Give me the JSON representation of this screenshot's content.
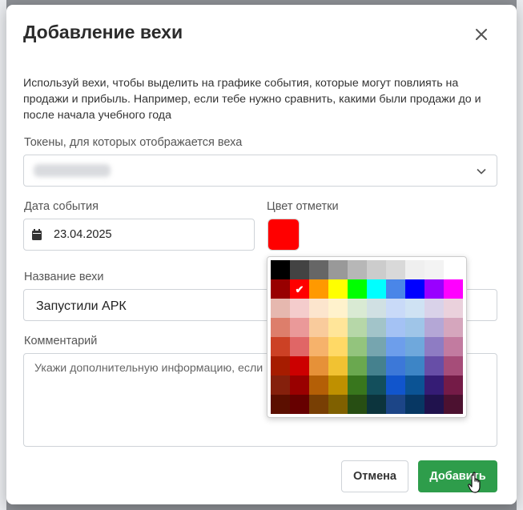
{
  "dialog": {
    "title": "Добавление вехи",
    "description": "Используй вехи, чтобы выделить на графике события, которые могут повлиять на продажи и прибыль. Например, если тебе нужно сравнить, какими были продажи до и после начала учебного года"
  },
  "tokens": {
    "label": "Токены, для которых отображается веха",
    "value": ""
  },
  "event_date": {
    "label": "Дата события",
    "value": "23.04.2025"
  },
  "marker_color": {
    "label": "Цвет отметки",
    "selected": "#ff0000"
  },
  "milestone_name": {
    "label": "Название вехи",
    "value": "Запустили АРК"
  },
  "comment": {
    "label": "Комментарий",
    "placeholder": "Укажи дополнительную информацию, если"
  },
  "palette": {
    "selected_index": 11,
    "rows": [
      [
        "#000000",
        "#434343",
        "#666666",
        "#999999",
        "#b7b7b7",
        "#cccccc",
        "#d9d9d9",
        "#efefef",
        "#f3f3f3",
        "#ffffff"
      ],
      [
        "#980000",
        "#ff0000",
        "#ff9900",
        "#ffff00",
        "#00ff00",
        "#00ffff",
        "#4a86e8",
        "#0000ff",
        "#9900ff",
        "#ff00ff"
      ],
      [
        "#e6b8af",
        "#f4cccc",
        "#fce5cd",
        "#fff2cc",
        "#d9ead3",
        "#d0e0e3",
        "#c9daf8",
        "#cfe2f3",
        "#d9d2e9",
        "#ead1dc"
      ],
      [
        "#dd7e6b",
        "#ea9999",
        "#f9cb9c",
        "#ffe599",
        "#b6d7a8",
        "#a2c4c9",
        "#a4c2f4",
        "#9fc5e8",
        "#b4a7d6",
        "#d5a6bd"
      ],
      [
        "#cc4125",
        "#e06666",
        "#f6b26b",
        "#ffd966",
        "#93c47d",
        "#76a5af",
        "#6d9eeb",
        "#6fa8dc",
        "#8e7cc3",
        "#c27ba0"
      ],
      [
        "#a61c00",
        "#cc0000",
        "#e69138",
        "#f1c232",
        "#6aa84f",
        "#45818e",
        "#3c78d8",
        "#3d85c6",
        "#674ea7",
        "#a64d79"
      ],
      [
        "#85200c",
        "#990000",
        "#b45f06",
        "#bf9000",
        "#38761d",
        "#134f5c",
        "#1155cc",
        "#0b5394",
        "#351c75",
        "#741b47"
      ],
      [
        "#5b0f00",
        "#660000",
        "#783f04",
        "#7f6000",
        "#274e13",
        "#0c343d",
        "#1c4587",
        "#073763",
        "#20124d",
        "#4c1130"
      ]
    ]
  },
  "buttons": {
    "cancel": "Отмена",
    "add": "Добавить"
  },
  "icons": {
    "close": "close-icon",
    "chevron": "chevron-down-icon",
    "calendar": "calendar-icon",
    "check": "✔",
    "cursor": "hand-pointer-icon"
  },
  "colors": {
    "primary_button": "#2e9d4b"
  }
}
